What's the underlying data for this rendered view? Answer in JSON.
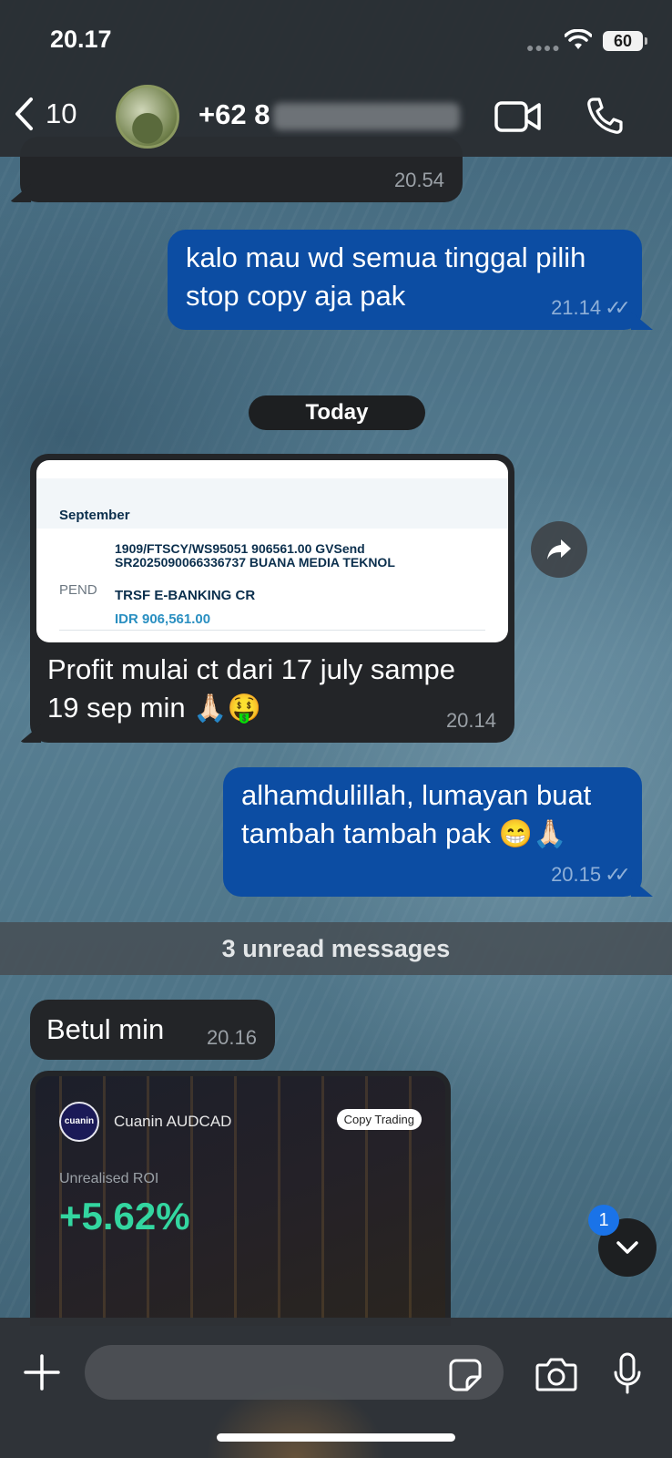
{
  "status_bar": {
    "time": "20.17",
    "battery": "60"
  },
  "header": {
    "back_count": "10",
    "contact_prefix": "+62 8"
  },
  "messages": {
    "m0": {
      "time": "20.54"
    },
    "m1": {
      "text_line1": "kalo mau wd semua tinggal pilih",
      "text_line2": "stop copy aja pak",
      "time": "21.14"
    },
    "date_separator": "Today",
    "m2": {
      "image": {
        "month": "September",
        "status": "PEND",
        "tx_line1": "1909/FTSCY/WS95051 906561.00 GVSend",
        "tx_line2": "SR2025090066336737 BUANA MEDIA TEKNOL",
        "tx_type": "TRSF E-BANKING CR",
        "amount": "IDR 906,561.00"
      },
      "text_line1": "Profit mulai ct dari 17 july sampe",
      "text_line2": "19 sep min",
      "emoji": "🙏🏻🤑",
      "time": "20.14"
    },
    "m3": {
      "text_line1": "alhamdulillah, lumayan buat",
      "text_line2": "tambah tambah pak",
      "emoji": "😁🙏🏻",
      "time": "20.15"
    },
    "unread_bar": "3 unread messages",
    "m4": {
      "text": "Betul min",
      "time": "20.16"
    },
    "m5": {
      "card": {
        "logo_text": "cuanin",
        "name": "Cuanin AUDCAD",
        "badge": "Copy Trading",
        "roi_label": "Unrealised ROI",
        "roi_value": "+5.62%"
      }
    }
  },
  "scroll_badge": "1",
  "composer": {
    "placeholder": ""
  },
  "colors": {
    "outgoing": "#0c4da3",
    "incoming": "#232528",
    "accent": "#1a73e8",
    "roi_green": "#33d6a0"
  }
}
